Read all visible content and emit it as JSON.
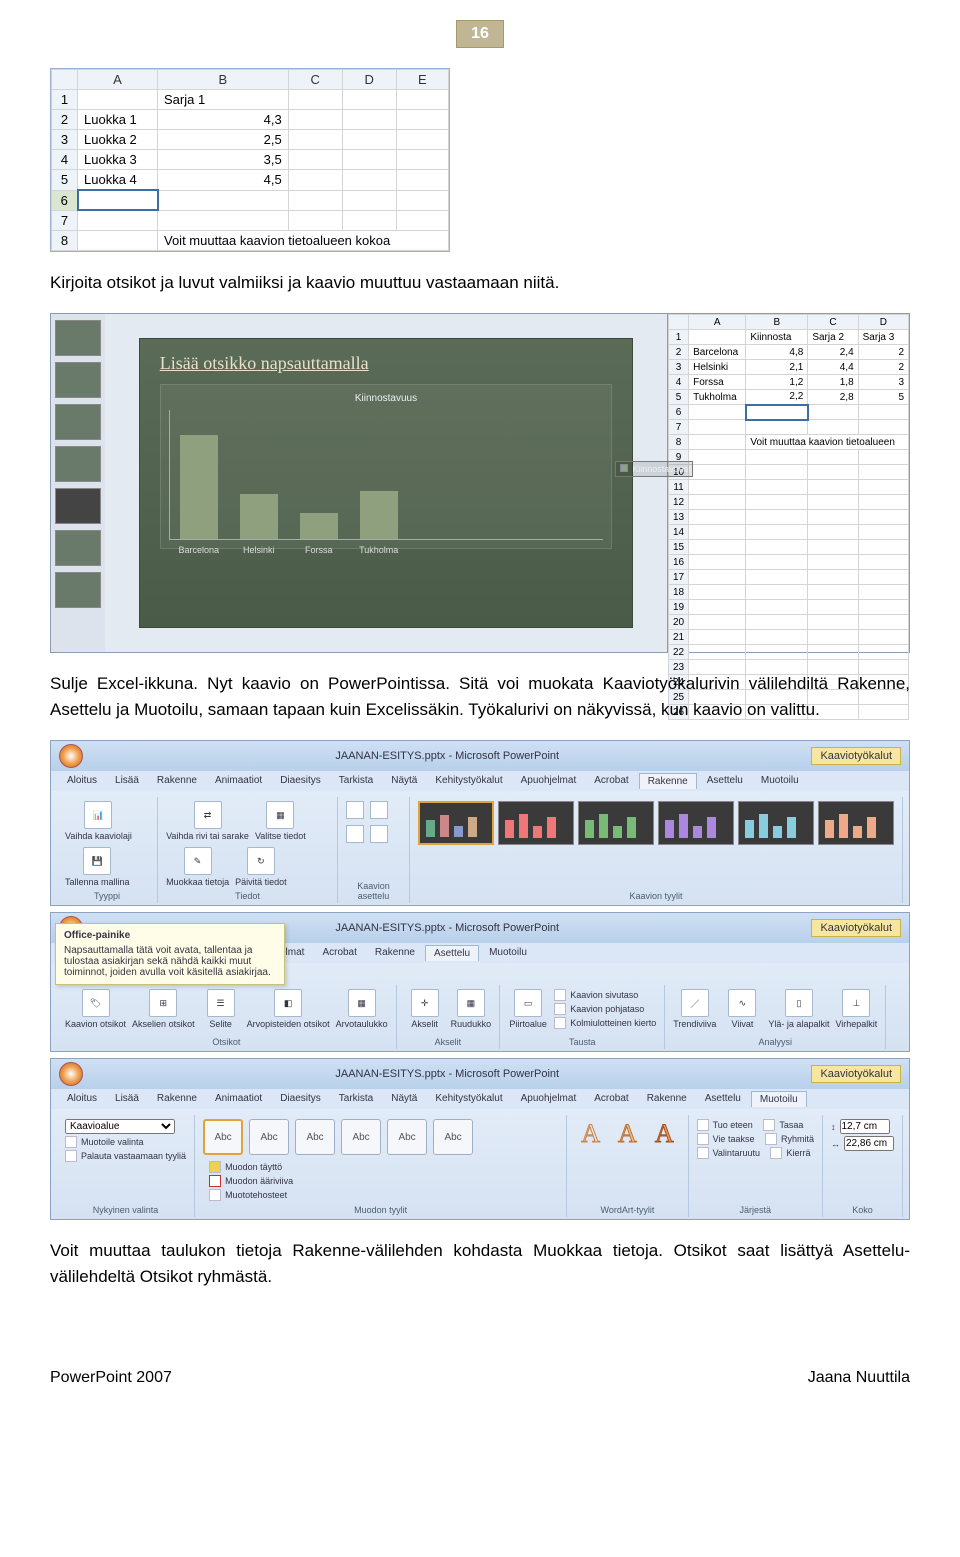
{
  "page_number": "16",
  "excel_top": {
    "columns": [
      "",
      "A",
      "B",
      "C",
      "D",
      "E"
    ],
    "rows": [
      {
        "n": "1",
        "a": "",
        "b": "Sarja 1",
        "c": "",
        "d": "",
        "e": ""
      },
      {
        "n": "2",
        "a": "Luokka 1",
        "b": "4,3",
        "c": "",
        "d": "",
        "e": ""
      },
      {
        "n": "3",
        "a": "Luokka 2",
        "b": "2,5",
        "c": "",
        "d": "",
        "e": ""
      },
      {
        "n": "4",
        "a": "Luokka 3",
        "b": "3,5",
        "c": "",
        "d": "",
        "e": ""
      },
      {
        "n": "5",
        "a": "Luokka 4",
        "b": "4,5",
        "c": "",
        "d": "",
        "e": ""
      },
      {
        "n": "6",
        "a": "",
        "b": "",
        "c": "",
        "d": "",
        "e": ""
      },
      {
        "n": "7",
        "a": "",
        "b": "",
        "c": "",
        "d": "",
        "e": ""
      },
      {
        "n": "8",
        "a": "",
        "b": "Voit muuttaa kaavion tietoalueen kokoa",
        "c": "",
        "d": "",
        "e": ""
      }
    ]
  },
  "para1": "Kirjoita otsikot ja luvut valmiiksi ja kaavio muuttuu vastaamaan niitä.",
  "slide_title": "Lisää otsikko napsauttamalla",
  "chart_title": "Kiinnostavuus",
  "legend_label": "Kiinnostavuus",
  "chart_data": {
    "type": "bar",
    "title": "Kiinnostavuus",
    "categories": [
      "Barcelona",
      "Helsinki",
      "Forssa",
      "Tukholma"
    ],
    "values": [
      4.8,
      2.1,
      1.2,
      2.2
    ],
    "xlabel": "",
    "ylabel": "",
    "ylim": [
      0,
      6
    ],
    "legend_items": [
      "Kiinnostavuus"
    ]
  },
  "excel_right": {
    "columns": [
      "",
      "A",
      "B",
      "C",
      "D"
    ],
    "rows": [
      {
        "n": "1",
        "a": "",
        "b": "Kiinnosta",
        "c": "Sarja 2",
        "d": "Sarja 3"
      },
      {
        "n": "2",
        "a": "Barcelona",
        "b": "4,8",
        "c": "2,4",
        "d": "2"
      },
      {
        "n": "3",
        "a": "Helsinki",
        "b": "2,1",
        "c": "4,4",
        "d": "2"
      },
      {
        "n": "4",
        "a": "Forssa",
        "b": "1,2",
        "c": "1,8",
        "d": "3"
      },
      {
        "n": "5",
        "a": "Tukholma",
        "b": "2,2",
        "c": "2,8",
        "d": "5"
      },
      {
        "n": "6",
        "a": "",
        "b": "",
        "c": "",
        "d": ""
      },
      {
        "n": "7",
        "a": "",
        "b": "",
        "c": "",
        "d": ""
      },
      {
        "n": "8",
        "a": "",
        "b": "Voit muuttaa kaavion tietoalueen",
        "c": "",
        "d": ""
      }
    ],
    "empty_rows": [
      "9",
      "10",
      "11",
      "12",
      "13",
      "14",
      "15",
      "16",
      "17",
      "18",
      "19",
      "20",
      "21",
      "22",
      "23",
      "24",
      "25",
      "26"
    ]
  },
  "para2": "Sulje Excel-ikkuna. Nyt kaavio on PowerPointissa. Sitä voi muokata Kaaviotyökalurivin välilehdiltä Rakenne, Asettelu ja Muotoilu, samaan tapaan kuin Excelissäkin. Työkalurivi on näkyvissä, kun kaavio on valittu.",
  "doc_title": "JAANAN-ESITYS.pptx - Microsoft PowerPoint",
  "context_tab": "Kaaviotyökalut",
  "main_tabs": [
    "Aloitus",
    "Lisää",
    "Rakenne",
    "Animaatiot",
    "Diaesitys",
    "Tarkista",
    "Näytä",
    "Kehitystyökalut",
    "Apuohjelmat",
    "Acrobat"
  ],
  "chart_tabs": [
    "Rakenne",
    "Asettelu",
    "Muotoilu"
  ],
  "ribbon1": {
    "group_tyyppi": "Tyyppi",
    "group_tiedot": "Tiedot",
    "group_kasettelu": "Kaavion asettelu",
    "group_ktyylit": "Kaavion tyylit",
    "btn_vaihda_kaaviolaji": "Vaihda kaaviolaji",
    "btn_tallenna_mallina": "Tallenna mallina",
    "btn_vaihda_rivi": "Vaihda rivi tai sarake",
    "btn_valitse_tiedot": "Valitse tiedot",
    "btn_muokkaa_tietoja": "Muokkaa tietoja",
    "btn_paivita_tiedot": "Päivitä tiedot"
  },
  "ribbon2": {
    "active_tab": "Asettelu",
    "group_otsikot": "Otsikot",
    "group_akselit": "Akselit",
    "group_tausta": "Tausta",
    "group_analyysi": "Analyysi",
    "btn_kaavion_otsikot": "Kaavion otsikot",
    "btn_akselien_otsikot": "Akselien otsikot",
    "btn_selite": "Selite",
    "btn_arvopiste": "Arvopisteiden otsikot",
    "btn_arvotaulukko": "Arvotaulukko",
    "btn_akselit": "Akselit",
    "btn_ruudukko": "Ruudukko",
    "btn_piirtoalue": "Piirtoalue",
    "btn_kaavion_sivu": "Kaavion sivutaso",
    "btn_kaavion_pohja": "Kaavion pohjataso",
    "btn_kolmiulott": "Kolmiulotteinen kierto",
    "btn_trendiviiva": "Trendiviiva",
    "btn_viivat": "Viivat",
    "btn_yla_ala": "Ylä- ja alapalkit",
    "btn_virhepalkit": "Virhepalkit",
    "tooltip_title": "Office-painike",
    "tooltip_text": "Napsauttamalla tätä voit avata, tallentaa ja tulostaa asiakirjan sekä nähdä kaikki muut toiminnot, joiden avulla voit käsitellä asiakirjaa."
  },
  "ribbon3": {
    "active_tab": "Muotoilu",
    "group_nykyinen": "Nykyinen valinta",
    "group_muodon_tyylit": "Muodon tyylit",
    "group_wordart": "WordArt-tyylit",
    "group_jarjesta": "Järjestä",
    "group_koko": "Koko",
    "dropdown_kaavioalue": "Kaavioalue",
    "btn_muotoile_valinta": "Muotoile valinta",
    "btn_palauta": "Palauta vastaamaan tyyliä",
    "shape_label": "Abc",
    "btn_muodon_taytto": "Muodon täyttö",
    "btn_muodon_aariiviva": "Muodon ääriviiva",
    "btn_muototehoseet": "Muototehosteet",
    "btn_tuo_eteen": "Tuo eteen",
    "btn_vie_taakse": "Vie taakse",
    "btn_valintaruutu": "Valintaruutu",
    "btn_tasaa": "Tasaa",
    "btn_ryhmita": "Ryhmitä",
    "btn_kierra": "Kierrä",
    "size_h": "12,7 cm",
    "size_w": "22,86 cm"
  },
  "para3": "Voit muuttaa taulukon tietoja Rakenne-välilehden kohdasta Muokkaa tietoja. Otsikot saat lisättyä Asettelu-välilehdeltä Otsikot ryhmästä.",
  "footer_left": "PowerPoint 2007",
  "footer_right": "Jaana Nuuttila"
}
